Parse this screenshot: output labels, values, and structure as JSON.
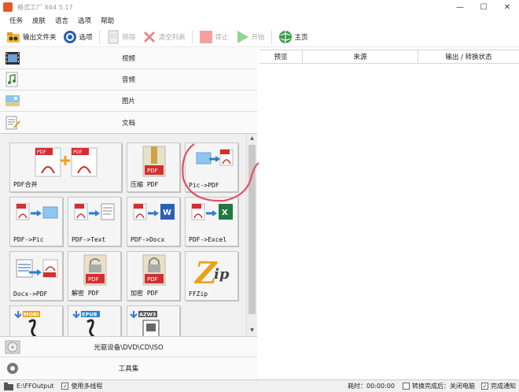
{
  "window": {
    "title": "格式工厂 X64 5.17",
    "controls": [
      "—",
      "☐",
      "✕"
    ]
  },
  "menu": [
    "任务",
    "皮肤",
    "语言",
    "选项",
    "帮助"
  ],
  "toolbar": {
    "output_folder": "输出文件夹",
    "options": "选项",
    "remove": "移除",
    "clear_list": "清空列表",
    "stop": "停止",
    "start": "开始",
    "home": "主页"
  },
  "categories": {
    "video": "视频",
    "audio": "音频",
    "image": "图片",
    "document": "文档",
    "disc": "光驱设备\\DVD\\CD\\ISO",
    "tools": "工具集"
  },
  "document_tools": [
    "PDF合并",
    "压缩 PDF",
    "Pic->PDF",
    "PDF->Pic",
    "PDF->Text",
    "PDF->Docx",
    "PDF->Excel",
    "Docx->PDF",
    "解密 PDF",
    "加密 PDF",
    "FFZip",
    "",
    "",
    ""
  ],
  "icon_badges": {
    "pdf": "PDF",
    "mobi": "MOBI",
    "epub": "EPUB",
    "azw3": "AZW3",
    "zip_letter": "Z",
    "zip_p": "ip"
  },
  "list_headers": {
    "preview": "预览",
    "source": "来源",
    "output_status": "输出 / 转换状态"
  },
  "status": {
    "output_path": "E:\\FFOutput",
    "multithread": "使用多线程",
    "elapsed": "耗时：00:00:00",
    "after_convert": "转换完成后：关闭电脑",
    "notify": "完成通知"
  },
  "colors": {
    "pdf_red": "#d32f2f",
    "accent_green": "#3bb54a",
    "stop_red": "#f08080",
    "annotation": "#e0506a"
  }
}
